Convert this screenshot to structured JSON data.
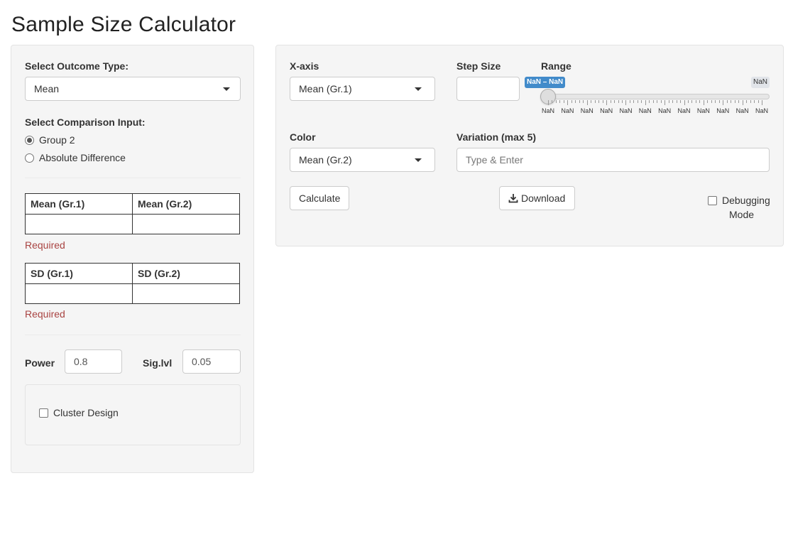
{
  "page": {
    "title": "Sample Size Calculator"
  },
  "sidebar": {
    "outcome_label": "Select Outcome Type:",
    "outcome_value": "Mean",
    "comparison_label": "Select Comparison Input:",
    "comparison_options": [
      {
        "label": "Group 2",
        "checked": true
      },
      {
        "label": "Absolute Difference",
        "checked": false
      }
    ],
    "mean_table": {
      "headers": [
        "Mean (Gr.1)",
        "Mean (Gr.2)"
      ],
      "values": [
        "",
        ""
      ]
    },
    "mean_required": "Required",
    "sd_table": {
      "headers": [
        "SD (Gr.1)",
        "SD (Gr.2)"
      ],
      "values": [
        "",
        ""
      ]
    },
    "sd_required": "Required",
    "power_label": "Power",
    "power_value": "0.8",
    "sig_label": "Sig.lvl",
    "sig_value": "0.05",
    "cluster_label": "Cluster Design"
  },
  "main": {
    "xaxis_label": "X-axis",
    "xaxis_value": "Mean (Gr.1)",
    "step_label": "Step Size",
    "step_value": "",
    "range_label": "Range",
    "range_badge": "NaN – NaN",
    "range_max": "NaN",
    "tick_labels": [
      "NaN",
      "NaN",
      "NaN",
      "NaN",
      "NaN",
      "NaN",
      "NaN",
      "NaN",
      "NaN",
      "NaN",
      "NaN",
      "NaN"
    ],
    "color_label": "Color",
    "color_value": "Mean (Gr.2)",
    "variation_label": "Variation (max 5)",
    "variation_placeholder": "Type & Enter",
    "calculate_label": "Calculate",
    "download_label": "Download",
    "debug_label_1": "Debugging",
    "debug_label_2": "Mode"
  },
  "icons": {
    "download": "download-icon",
    "caret": "chevron-down-icon"
  }
}
